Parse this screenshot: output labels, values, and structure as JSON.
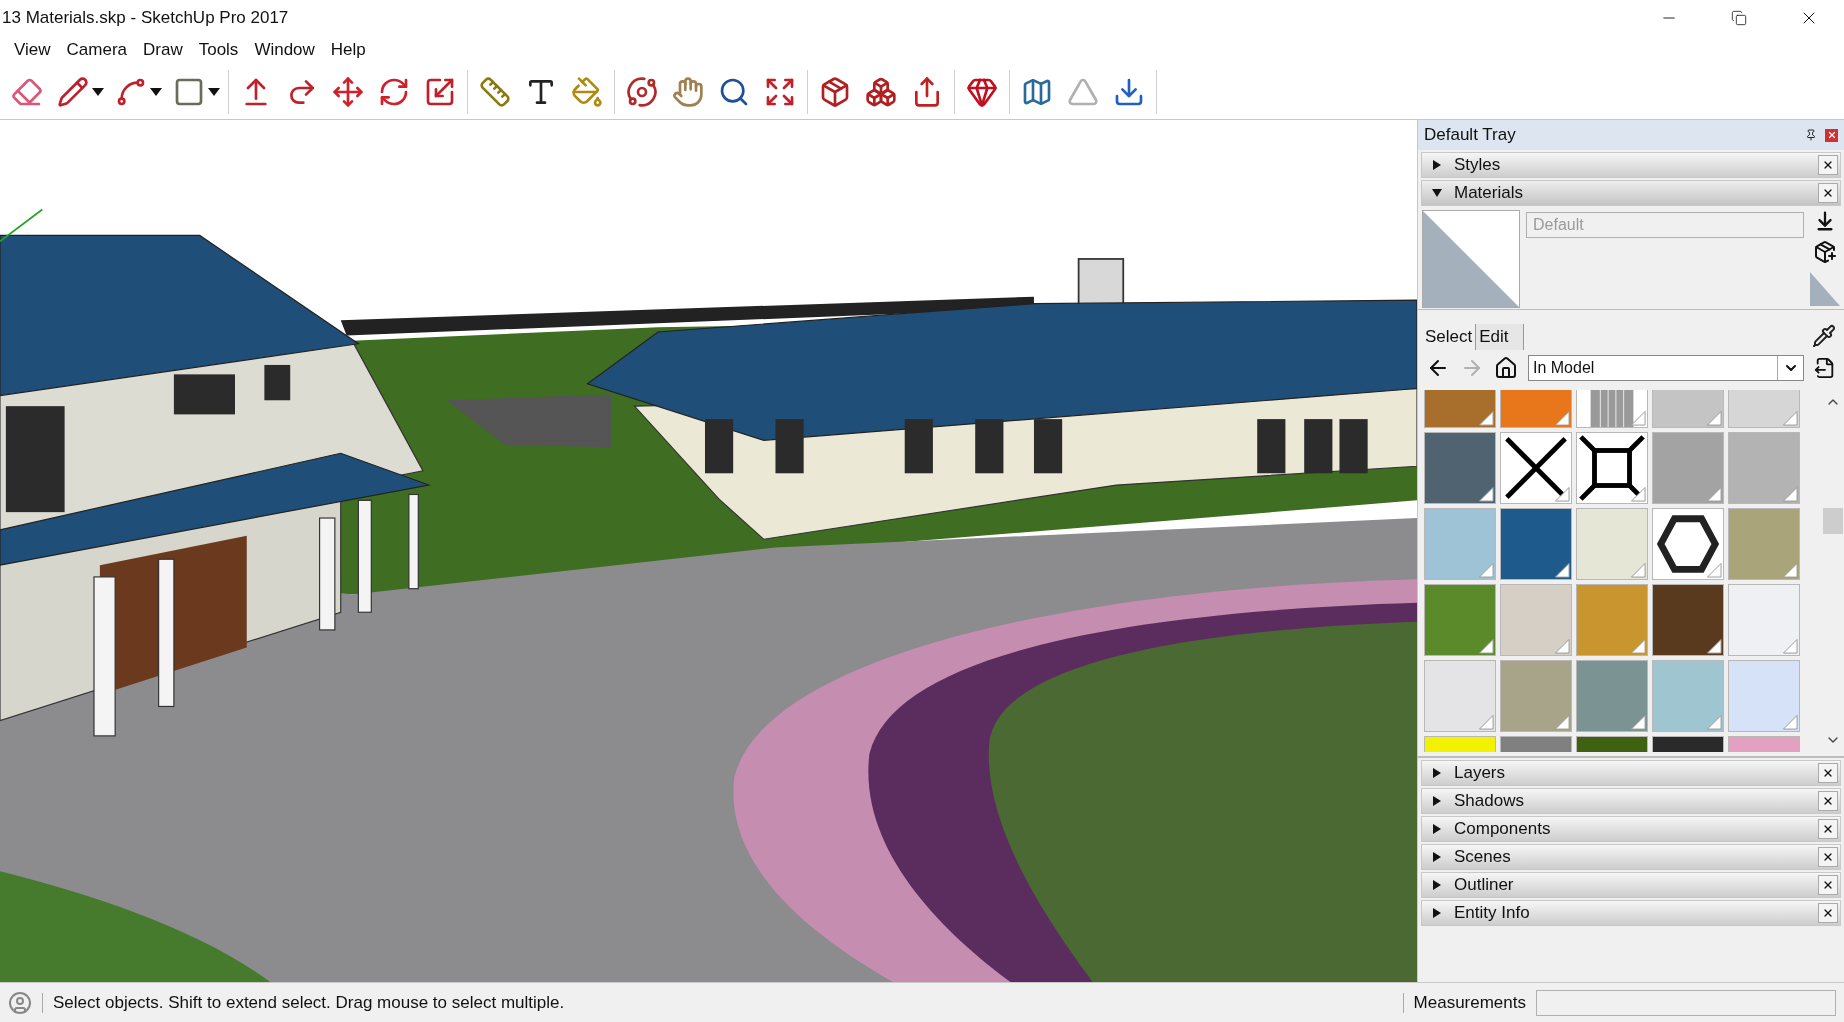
{
  "window": {
    "title": "13 Materials.skp - SketchUp Pro 2017"
  },
  "menu": [
    "View",
    "Camera",
    "Draw",
    "Tools",
    "Window",
    "Help"
  ],
  "tray": {
    "title": "Default Tray",
    "panels_top": [
      {
        "title": "Styles",
        "expanded": false
      },
      {
        "title": "Materials",
        "expanded": true
      }
    ],
    "materials": {
      "name_field": {
        "value": "Default",
        "disabled": true
      },
      "tabs": [
        {
          "label": "Select",
          "selected": true
        },
        {
          "label": "Edit",
          "selected": false
        }
      ],
      "nav": [
        {
          "kind": "back",
          "disabled": false
        },
        {
          "kind": "forward",
          "disabled": true
        },
        {
          "kind": "home",
          "disabled": false
        }
      ],
      "collection": "In Model",
      "swatches": [
        {
          "kind": "swatch",
          "color": "#a86f2c"
        },
        {
          "kind": "swatch",
          "color": "#e8761a"
        },
        {
          "kind": "stripes",
          "color": "#9a9a9a"
        },
        {
          "kind": "swatch",
          "color": "#c4c4c4"
        },
        {
          "kind": "swatch",
          "color": "#d6d6d6"
        },
        {
          "kind": "swatch",
          "color": "#4f6470"
        },
        {
          "kind": "cross",
          "color": "#000000"
        },
        {
          "kind": "frame",
          "color": "#000000"
        },
        {
          "kind": "swatch",
          "color": "#a3a3a3"
        },
        {
          "kind": "swatch",
          "color": "#b3b3b3"
        },
        {
          "kind": "swatch",
          "color": "#9fc3d6"
        },
        {
          "kind": "swatch",
          "color": "#1f5a8c"
        },
        {
          "kind": "swatch",
          "color": "#e6e6d6"
        },
        {
          "kind": "hexagon",
          "color": "#222222"
        },
        {
          "kind": "swatch",
          "color": "#a9a47a"
        },
        {
          "kind": "swatch",
          "color": "#5a8a2a"
        },
        {
          "kind": "swatch",
          "color": "#d6cfc6"
        },
        {
          "kind": "swatch",
          "color": "#c8952f"
        },
        {
          "kind": "swatch",
          "color": "#5a3a1e"
        },
        {
          "kind": "swatch",
          "color": "#eef0f4"
        },
        {
          "kind": "swatch",
          "color": "#e4e4e6"
        },
        {
          "kind": "swatch",
          "color": "#a8a48a"
        },
        {
          "kind": "swatch",
          "color": "#7c9393"
        },
        {
          "kind": "swatch",
          "color": "#9ec5d0"
        },
        {
          "kind": "swatch",
          "color": "#d5e2f7"
        },
        {
          "kind": "swatch",
          "color": "#f2f200"
        },
        {
          "kind": "swatch",
          "color": "#808080"
        },
        {
          "kind": "swatch",
          "color": "#3e6212"
        },
        {
          "kind": "swatch",
          "color": "#2a2a2a"
        },
        {
          "kind": "swatch",
          "color": "#e3a0c0"
        }
      ]
    },
    "panels_bottom": [
      {
        "title": "Layers",
        "expanded": false
      },
      {
        "title": "Shadows",
        "expanded": false
      },
      {
        "title": "Components",
        "expanded": false
      },
      {
        "title": "Scenes",
        "expanded": false
      },
      {
        "title": "Outliner",
        "expanded": false
      },
      {
        "title": "Entity Info",
        "expanded": false
      }
    ]
  },
  "status_bar": {
    "message": "Select objects. Shift to extend select. Drag mouse to select multiple.",
    "measurements_label": "Measurements"
  }
}
